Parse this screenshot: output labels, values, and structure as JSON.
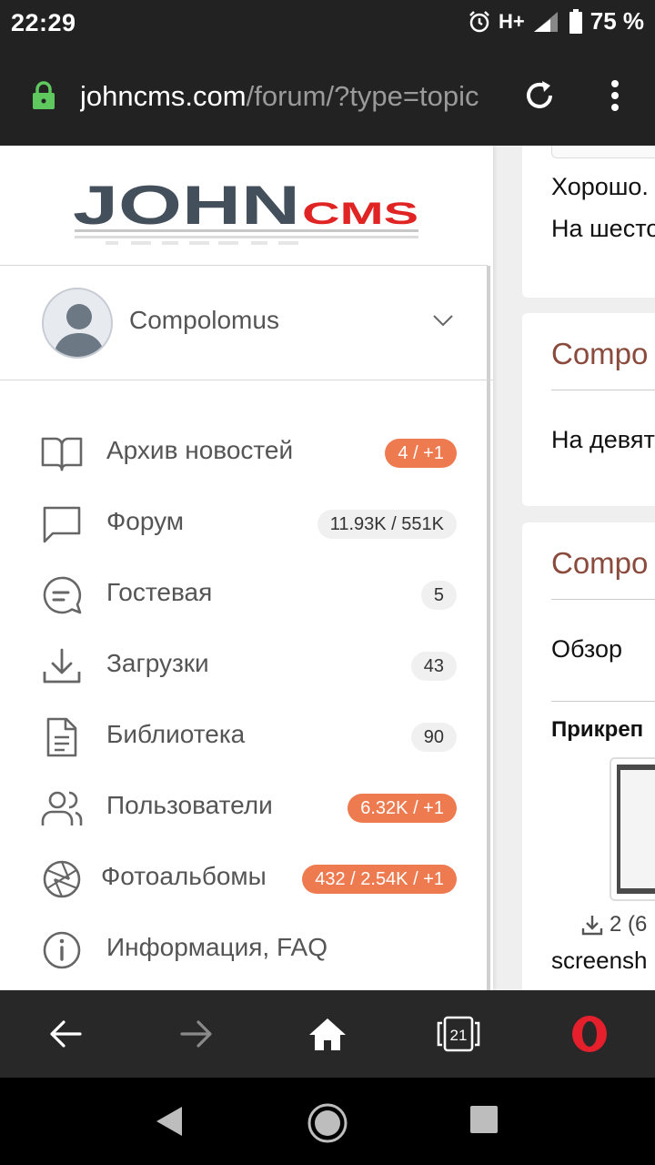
{
  "status": {
    "time": "22:29",
    "network": "H+",
    "battery": "75 %"
  },
  "address": {
    "host": "johncms.com",
    "path": "/forum/?type=topic"
  },
  "logo": {
    "john": "JOHN",
    "cms": "CMS"
  },
  "user": {
    "name": "Compolomus"
  },
  "menu": [
    {
      "label": "Архив новостей",
      "badge": "4 / +1",
      "badge_style": "orange",
      "icon": "book-icon"
    },
    {
      "label": "Форум",
      "badge": "11.93K / 551K",
      "badge_style": "gray",
      "icon": "chat-bubble-icon"
    },
    {
      "label": "Гостевая",
      "badge": "5",
      "badge_style": "gray",
      "icon": "guestbook-icon"
    },
    {
      "label": "Загрузки",
      "badge": "43",
      "badge_style": "gray",
      "icon": "download-icon"
    },
    {
      "label": "Библиотека",
      "badge": "90",
      "badge_style": "gray",
      "icon": "document-icon"
    },
    {
      "label": "Пользователи",
      "badge": "6.32K / +1",
      "badge_style": "orange",
      "icon": "users-icon"
    },
    {
      "label": "Фотоальбомы",
      "badge": "432 / 2.54K / +1",
      "badge_style": "orange",
      "icon": "aperture-icon"
    },
    {
      "label": "Информация, FAQ",
      "badge": "",
      "badge_style": "",
      "icon": "info-icon"
    }
  ],
  "background": {
    "card1_line1": "Хорошо.",
    "card1_line2": "На шесто",
    "card2_author": "Compo",
    "card2_text": "На девят",
    "card3_author": "Compo",
    "card3_text": "Обзор",
    "card3_attach": "Прикреп",
    "card3_downloads": "2 (6",
    "card3_filename": "screensh"
  },
  "bottomnav": {
    "tabs_count": "21"
  },
  "colors": {
    "accent": "#ee7a50",
    "logo_dark": "#444f5c",
    "logo_red": "#e02424",
    "bar": "#222222"
  }
}
